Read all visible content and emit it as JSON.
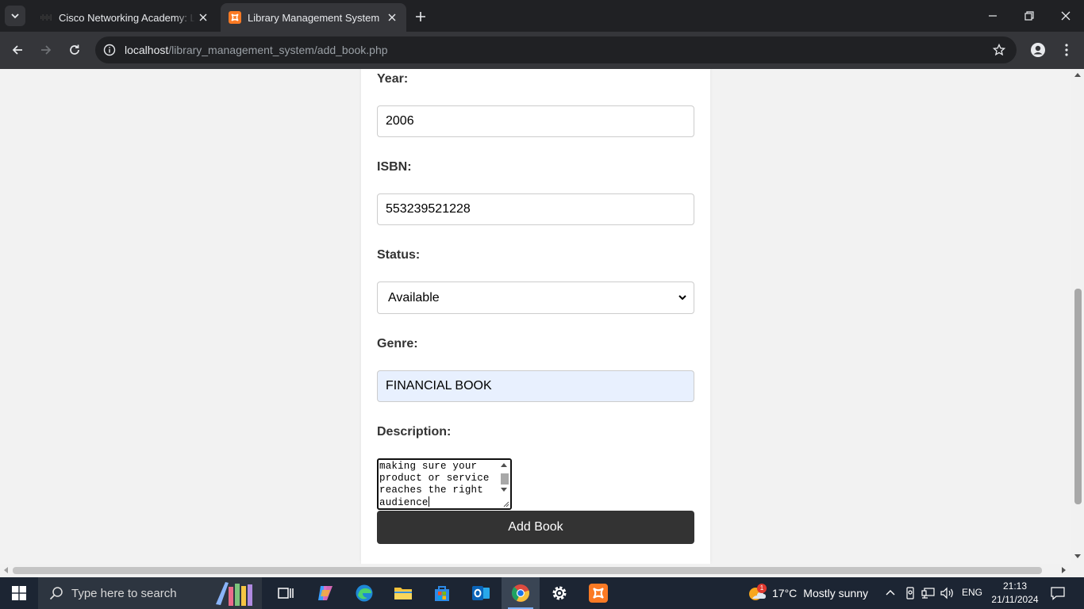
{
  "browser": {
    "tabs": [
      {
        "title": "Cisco Networking Academy: Lea",
        "active": false
      },
      {
        "title": "Library Management System",
        "active": true
      }
    ],
    "url_host": "localhost",
    "url_path": "/library_management_system/add_book.php"
  },
  "form": {
    "year": {
      "label": "Year:",
      "value": "2006"
    },
    "isbn": {
      "label": "ISBN:",
      "value": "553239521228"
    },
    "status": {
      "label": "Status:",
      "selected": "Available"
    },
    "genre": {
      "label": "Genre:",
      "value": "FINANCIAL BOOK"
    },
    "description": {
      "label": "Description:",
      "visible_text": "making sure your\nproduct or service\nreaches the right\naudience"
    },
    "submit_label": "Add Book"
  },
  "taskbar": {
    "search_placeholder": "Type here to search",
    "weather": {
      "temperature": "17°C",
      "condition": "Mostly sunny",
      "badge": "1"
    },
    "language": "ENG",
    "time": "21:13",
    "date": "21/11/2024"
  },
  "colors": {
    "chrome_dark": "#202124",
    "toolbar": "#35363a",
    "submit_button": "#333333",
    "autofill": "#e8f0fe",
    "xampp_orange": "#fb7a24",
    "taskbar": "#1c2533"
  }
}
